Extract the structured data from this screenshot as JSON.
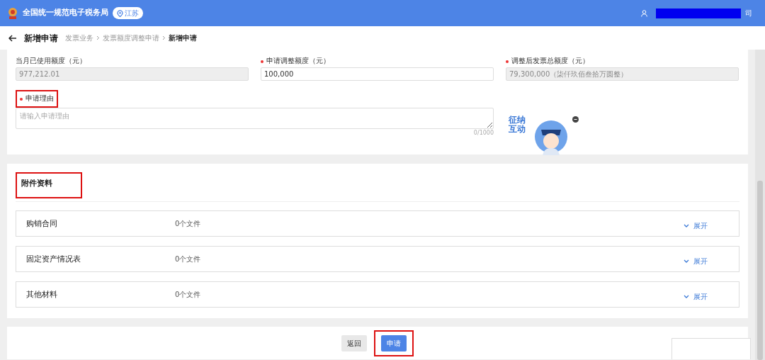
{
  "topbar": {
    "title": "全国统一规范电子税务局",
    "region": "江苏",
    "user_suffix": "司"
  },
  "header": {
    "title": "新增申请",
    "breadcrumb": [
      {
        "label": "发票业务",
        "current": false
      },
      {
        "label": "发票额度调整申请",
        "current": false
      },
      {
        "label": "新增申请",
        "current": true
      }
    ]
  },
  "fields": [
    {
      "label": "当月已使用额度（元）",
      "required": false,
      "value": "977,212.01",
      "disabled": true
    },
    {
      "label": "申请调整额度（元）",
      "required": true,
      "value": "100,000",
      "disabled": false
    },
    {
      "label": "调整后发票总额度（元）",
      "required": true,
      "value": "79,300,000（柒仟玖佰叁拾万圆整）",
      "disabled": true
    }
  ],
  "reason": {
    "label": "申请理由",
    "required": true,
    "placeholder": "请输入申请理由",
    "counter": "0/1000",
    "highlighted": true
  },
  "assistant": {
    "caption": "征纳互动"
  },
  "attachments": {
    "title": "附件资料",
    "highlighted": true,
    "items": [
      {
        "name": "购销合同",
        "count": "0个文件",
        "toggle": "展开",
        "expanded": false
      },
      {
        "name": "固定资产情况表",
        "count": "0个文件",
        "toggle": "展开",
        "expanded": false
      },
      {
        "name": "其他材料",
        "count": "0个文件",
        "toggle": "展开",
        "expanded": false
      }
    ]
  },
  "actions": [
    {
      "label": "返回",
      "kind": "secondary",
      "highlighted": false
    },
    {
      "label": "申请",
      "kind": "primary",
      "highlighted": true
    }
  ]
}
